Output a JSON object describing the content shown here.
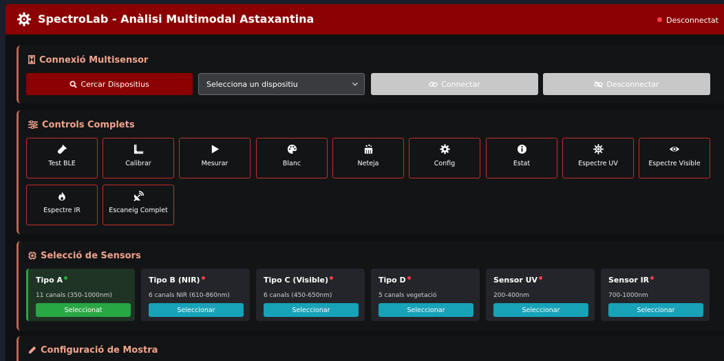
{
  "header": {
    "title": "SpectroLab - Anàlisi Multimodal Astaxantina",
    "status": "Desconnectat",
    "status_color": "#ff3b48",
    "icon": "gear-atom-icon"
  },
  "connection": {
    "title": "Connexió Multisensor",
    "search_label": "Cercar Dispositius",
    "device_select": "Selecciona un dispositiu",
    "connect_label": "Connectar",
    "disconnect_label": "Desconnectar"
  },
  "controls": {
    "title": "Controls Complets",
    "buttons": [
      {
        "label": "Test BLE",
        "icon": "vial-icon"
      },
      {
        "label": "Calibrar",
        "icon": "ruler-icon"
      },
      {
        "label": "Mesurar",
        "icon": "play-icon"
      },
      {
        "label": "Blanc",
        "icon": "palette-icon"
      },
      {
        "label": "Neteja",
        "icon": "broom-icon"
      },
      {
        "label": "Config",
        "icon": "gear-icon"
      },
      {
        "label": "Estat",
        "icon": "info-icon"
      },
      {
        "label": "Espectre UV",
        "icon": "sun-icon"
      },
      {
        "label": "Espectre Visible",
        "icon": "eye-icon"
      },
      {
        "label": "Espectre IR",
        "icon": "fire-icon"
      },
      {
        "label": "Escaneig Complet",
        "icon": "satellite-dish-icon"
      }
    ]
  },
  "sensors": {
    "title": "Selecció de Sensors",
    "items": [
      {
        "name": "Tipo A",
        "desc": "11 canals (350-1000nm)",
        "button": "Seleccionat",
        "active": true,
        "dot_color": "#28a745"
      },
      {
        "name": "Tipo B (NIR)",
        "desc": "6 canals NIR (610-860nm)",
        "button": "Seleccionar",
        "active": false,
        "dot_color": "#ff3b48"
      },
      {
        "name": "Tipo C (Visible)",
        "desc": "6 canals (450-650nm)",
        "button": "Seleccionar",
        "active": false,
        "dot_color": "#ff3b48"
      },
      {
        "name": "Tipo D",
        "desc": "5 canals vegetació",
        "button": "Seleccionar",
        "active": false,
        "dot_color": "#ff3b48"
      },
      {
        "name": "Sensor UV",
        "desc": "200-400nm",
        "button": "Seleccionar",
        "active": false,
        "dot_color": "#ff3b48"
      },
      {
        "name": "Sensor IR",
        "desc": "700-1000nm",
        "button": "Seleccionar",
        "active": false,
        "dot_color": "#ff3b48"
      }
    ]
  },
  "sample": {
    "title": "Configuració de Mostra"
  },
  "colors": {
    "brand": "#8b0000",
    "accent": "#f0a58d",
    "card_border": "#c0654d",
    "control_border": "#c6302a",
    "select_button": "#17a2b8",
    "selected_button": "#28a745"
  }
}
